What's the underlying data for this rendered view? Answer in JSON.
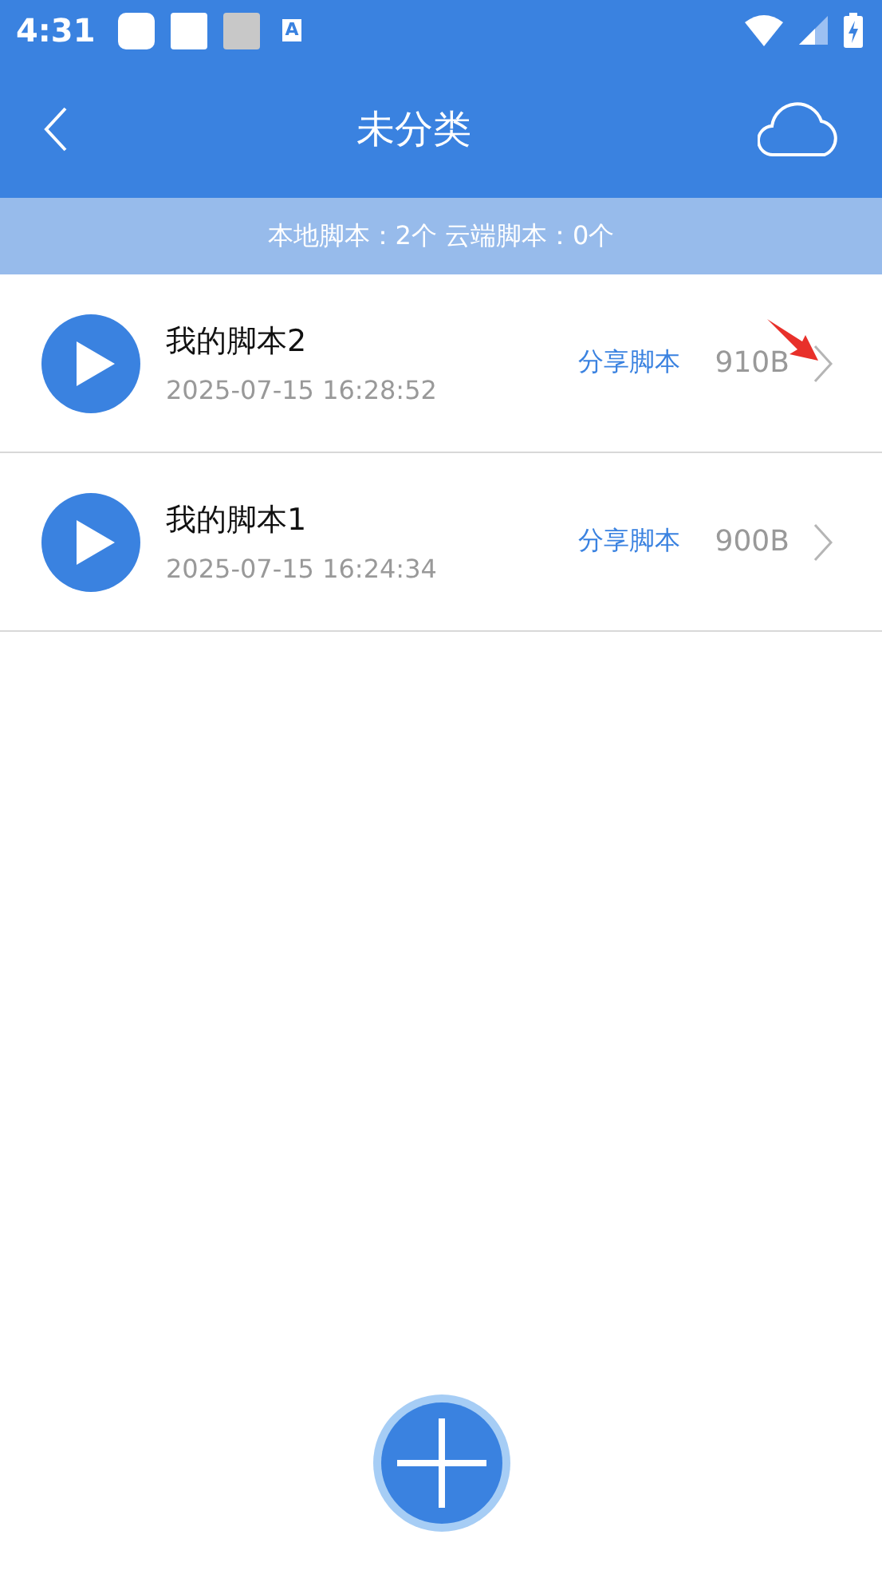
{
  "status_bar": {
    "time": "4:31",
    "notification_badge": "A"
  },
  "app_bar": {
    "title": "未分类"
  },
  "summary": "本地脚本：2个 云端脚本：0个",
  "scripts": [
    {
      "name": "我的脚本2",
      "date": "2025-07-15 16:28:52",
      "share": "分享脚本",
      "size": "910B",
      "annotated": true
    },
    {
      "name": "我的脚本1",
      "date": "2025-07-15 16:24:34",
      "share": "分享脚本",
      "size": "900B",
      "annotated": false
    }
  ]
}
